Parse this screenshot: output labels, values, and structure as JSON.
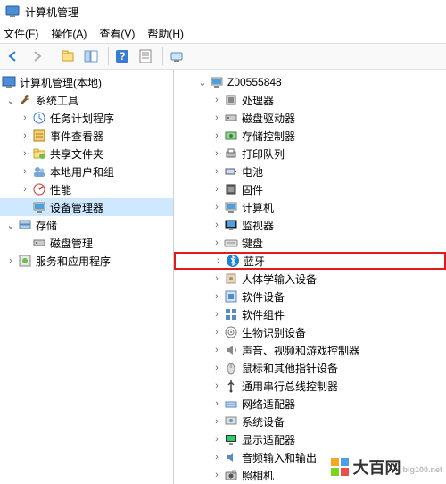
{
  "window": {
    "title": "计算机管理"
  },
  "menu": {
    "file": "文件(F)",
    "action": "操作(A)",
    "view": "查看(V)",
    "help": "帮助(H)"
  },
  "left_tree": {
    "root": "计算机管理(本地)",
    "sys_tools": "系统工具",
    "task_sched": "任务计划程序",
    "event_viewer": "事件查看器",
    "shared_folders": "共享文件夹",
    "local_users": "本地用户和组",
    "performance": "性能",
    "device_mgr": "设备管理器",
    "storage": "存储",
    "disk_mgmt": "磁盘管理",
    "services": "服务和应用程序"
  },
  "right_tree": {
    "root": "Z00555848",
    "items": [
      {
        "label": "处理器",
        "icon": "cpu"
      },
      {
        "label": "磁盘驱动器",
        "icon": "disk"
      },
      {
        "label": "存储控制器",
        "icon": "storage-ctrl"
      },
      {
        "label": "打印队列",
        "icon": "printer"
      },
      {
        "label": "电池",
        "icon": "battery"
      },
      {
        "label": "固件",
        "icon": "firmware"
      },
      {
        "label": "计算机",
        "icon": "computer"
      },
      {
        "label": "监视器",
        "icon": "monitor"
      },
      {
        "label": "键盘",
        "icon": "keyboard"
      },
      {
        "label": "蓝牙",
        "icon": "bluetooth",
        "hl": true
      },
      {
        "label": "人体学输入设备",
        "icon": "hid"
      },
      {
        "label": "软件设备",
        "icon": "software"
      },
      {
        "label": "软件组件",
        "icon": "component"
      },
      {
        "label": "生物识别设备",
        "icon": "biometric"
      },
      {
        "label": "声音、视频和游戏控制器",
        "icon": "sound"
      },
      {
        "label": "鼠标和其他指针设备",
        "icon": "mouse"
      },
      {
        "label": "通用串行总线控制器",
        "icon": "usb"
      },
      {
        "label": "网络适配器",
        "icon": "network"
      },
      {
        "label": "系统设备",
        "icon": "system"
      },
      {
        "label": "显示适配器",
        "icon": "display"
      },
      {
        "label": "音频输入和输出",
        "icon": "audio"
      },
      {
        "label": "照相机",
        "icon": "camera"
      }
    ]
  },
  "watermark": {
    "brand": "大百网",
    "url": "big100.net"
  }
}
